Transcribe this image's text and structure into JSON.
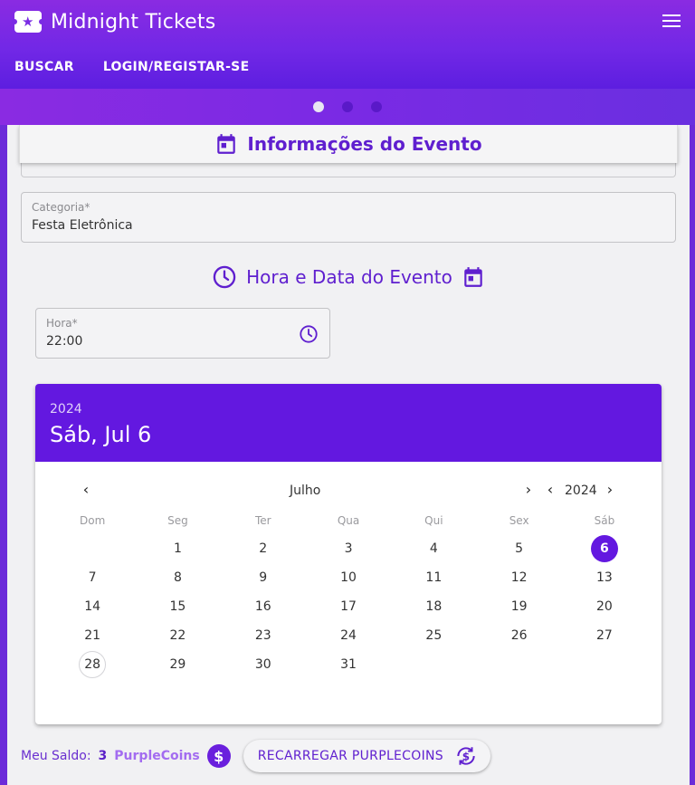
{
  "app": {
    "title": "Midnight Tickets",
    "nav": [
      "BUSCAR",
      "LOGIN/REGISTAR-SE"
    ]
  },
  "section": {
    "title": "Informações do Evento"
  },
  "categoria": {
    "label": "Categoria*",
    "value": "Festa Eletrônica"
  },
  "schedule": {
    "title": "Hora e Data do Evento",
    "hora_label": "Hora*",
    "hora_value": "22:00"
  },
  "date_picker": {
    "year": "2024",
    "selected_date": "Sáb, Jul 6",
    "month": "Julho",
    "year_nav": "2024",
    "weekdays": [
      "Dom",
      "Seg",
      "Ter",
      "Qua",
      "Qui",
      "Sex",
      "Sáb"
    ],
    "days": [
      "1",
      "2",
      "3",
      "4",
      "5",
      "6",
      "7",
      "8",
      "9",
      "10",
      "11",
      "12",
      "13",
      "14",
      "15",
      "16",
      "17",
      "18",
      "19",
      "20",
      "21",
      "22",
      "23",
      "24",
      "25",
      "26",
      "27",
      "28",
      "29",
      "30",
      "31"
    ],
    "selected_day": "6",
    "today_day": "28"
  },
  "balance": {
    "label": "Meu Saldo:",
    "amount": "3",
    "unit": "PurpleCoins",
    "recharge_label": "RECARREGAR PURPLECOINS"
  },
  "colors": {
    "primary": "#6318e0",
    "header_gradient_start": "#8a2be2",
    "header_gradient_end": "#5d1ee0"
  },
  "icons": {
    "calendar": "calendar-icon",
    "clock": "clock-icon",
    "coin": "dollar-coin-icon",
    "recharge": "currency-exchange-icon"
  }
}
